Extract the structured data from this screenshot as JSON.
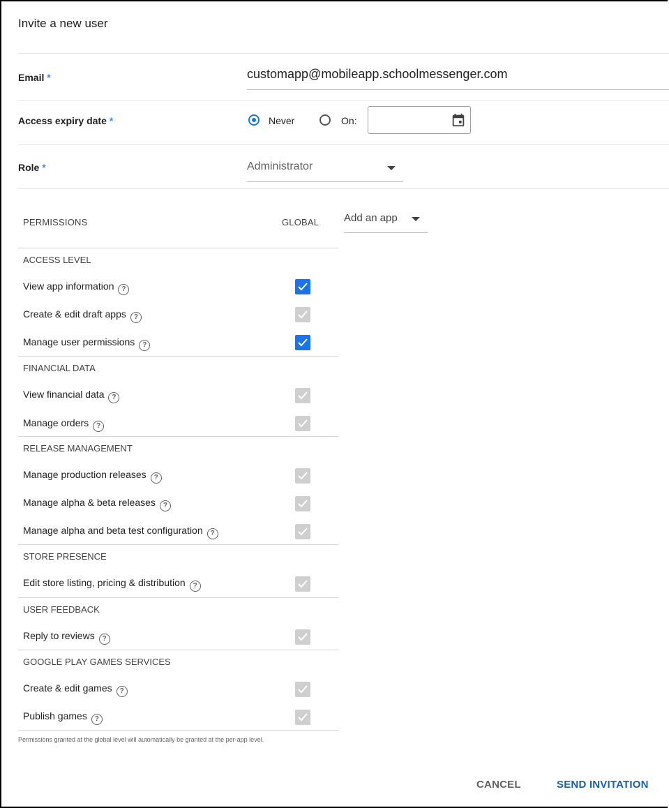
{
  "dialog": {
    "title": "Invite a new user",
    "required_marker": "*"
  },
  "email": {
    "label": "Email",
    "value": "customapp@mobileapp.schoolmessenger.com"
  },
  "expiry": {
    "label": "Access expiry date",
    "never_label": "Never",
    "on_label": "On:",
    "selected": "Never",
    "date_value": "",
    "calendar_icon": "calendar-icon"
  },
  "role": {
    "label": "Role",
    "value": "Administrator"
  },
  "permissions": {
    "header": "PERMISSIONS",
    "global_header": "GLOBAL",
    "add_app_label": "Add an app",
    "sections": [
      {
        "title": "ACCESS LEVEL",
        "items": [
          {
            "label": "View app information",
            "state": "checked"
          },
          {
            "label": "Create & edit draft apps",
            "state": "disabled"
          },
          {
            "label": "Manage user permissions",
            "state": "checked"
          }
        ]
      },
      {
        "title": "FINANCIAL DATA",
        "items": [
          {
            "label": "View financial data",
            "state": "disabled"
          },
          {
            "label": "Manage orders",
            "state": "disabled"
          }
        ]
      },
      {
        "title": "RELEASE MANAGEMENT",
        "items": [
          {
            "label": "Manage production releases",
            "state": "disabled"
          },
          {
            "label": "Manage alpha & beta releases",
            "state": "disabled"
          },
          {
            "label": "Manage alpha and beta test configuration",
            "state": "disabled"
          }
        ]
      },
      {
        "title": "STORE PRESENCE",
        "items": [
          {
            "label": "Edit store listing, pricing & distribution",
            "state": "disabled"
          }
        ]
      },
      {
        "title": "USER FEEDBACK",
        "items": [
          {
            "label": "Reply to reviews",
            "state": "disabled"
          }
        ]
      },
      {
        "title": "GOOGLE PLAY GAMES SERVICES",
        "items": [
          {
            "label": "Create & edit games",
            "state": "disabled"
          },
          {
            "label": "Publish games",
            "state": "disabled"
          }
        ]
      }
    ],
    "note": "Permissions granted at the global level will automatically be granted at the per-app level."
  },
  "actions": {
    "cancel_label": "CANCEL",
    "send_label": "SEND INVITATION"
  },
  "colors": {
    "accent": "#1a73e8",
    "required": "#4285f4",
    "disabled_checkbox": "#cfcfcf",
    "cancel_text": "#616161",
    "send_text": "#1a5fa8"
  }
}
